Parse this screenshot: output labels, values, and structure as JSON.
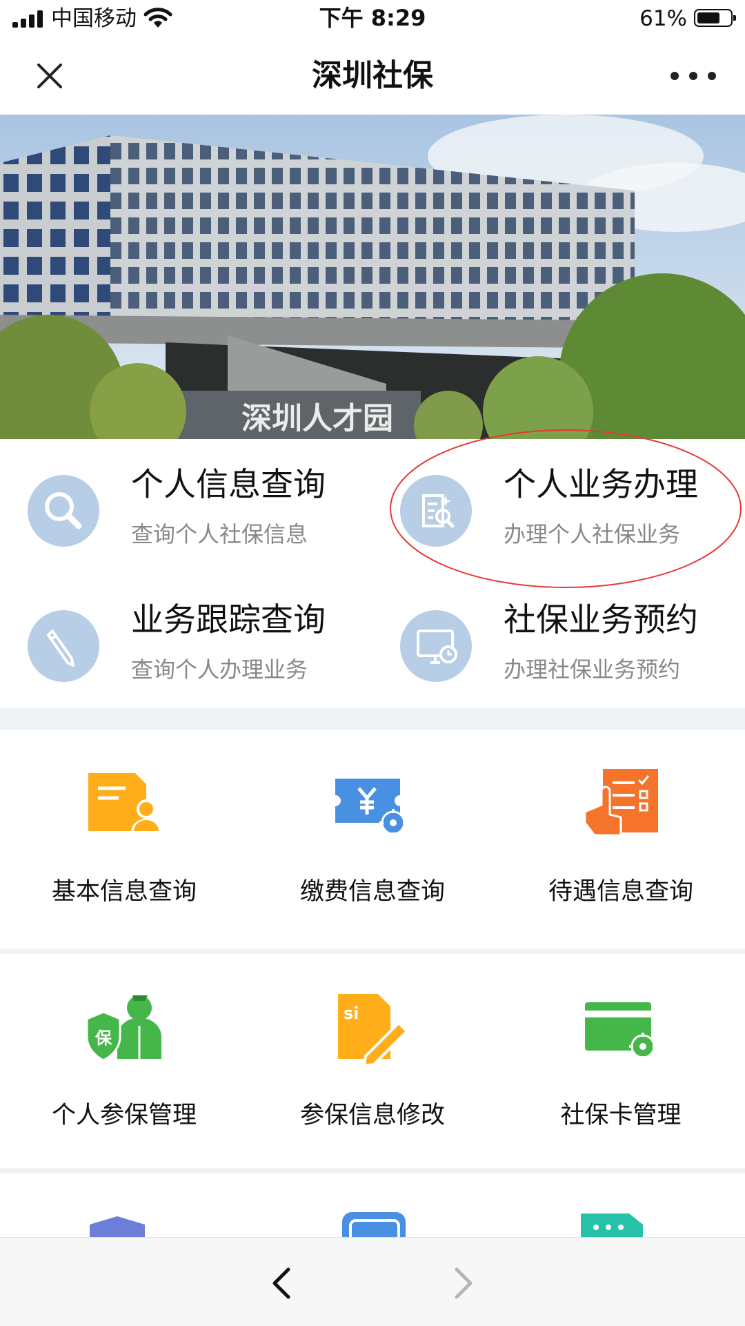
{
  "status_bar": {
    "carrier": "中国移动",
    "time": "下午 8:29",
    "battery": "61%"
  },
  "nav": {
    "title": "深圳社保"
  },
  "banner": {
    "sign_text": "深圳人才园"
  },
  "quick_services": [
    {
      "title": "个人信息查询",
      "subtitle": "查询个人社保信息",
      "icon": "magnifier-icon"
    },
    {
      "title": "个人业务办理",
      "subtitle": "办理个人社保业务",
      "icon": "document-search-icon"
    },
    {
      "title": "业务跟踪查询",
      "subtitle": "查询个人办理业务",
      "icon": "pencil-icon"
    },
    {
      "title": "社保业务预约",
      "subtitle": "办理社保业务预约",
      "icon": "monitor-clock-icon"
    }
  ],
  "grid": [
    {
      "label": "基本信息查询",
      "icon": "profile-card-icon",
      "color": "#FFAE1A"
    },
    {
      "label": "缴费信息查询",
      "icon": "yuan-ticket-gear-icon",
      "color": "#4A90E2"
    },
    {
      "label": "待遇信息查询",
      "icon": "hand-checklist-icon",
      "color": "#F5732A"
    },
    {
      "label": "个人参保管理",
      "icon": "shield-person-icon",
      "color": "#45B649"
    },
    {
      "label": "参保信息修改",
      "icon": "si-document-edit-icon",
      "color": "#FFAE1A"
    },
    {
      "label": "社保卡管理",
      "icon": "card-gear-icon",
      "color": "#45B649"
    }
  ],
  "shield_text": "保",
  "si_text": "si",
  "colors": {
    "quick_icon_bg": "#B8CDE6",
    "annotation": "#E53935"
  }
}
